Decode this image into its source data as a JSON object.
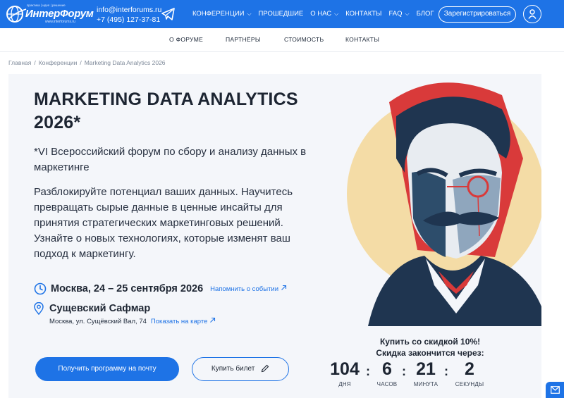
{
  "header": {
    "logo": {
      "tagline": "практика | идея | решение",
      "brand": "ИнтерФорум",
      "site": "www.interforums.ru"
    },
    "email": "info@interforums.ru",
    "phone": "+7 (495) 127-37-81",
    "nav": [
      {
        "label": "КОНФЕРЕНЦИИ",
        "dropdown": true
      },
      {
        "label": "ПРОШЕДШИЕ",
        "dropdown": false
      },
      {
        "label": "О НАС",
        "dropdown": true
      },
      {
        "label": "КОНТАКТЫ",
        "dropdown": false
      },
      {
        "label": "FAQ",
        "dropdown": true
      },
      {
        "label": "БЛОГ",
        "dropdown": false
      }
    ],
    "register_label": "Зарегистрироваться"
  },
  "subnav": [
    "О ФОРУМЕ",
    "ПАРТНЁРЫ",
    "СТОИМОСТЬ",
    "КОНТАКТЫ"
  ],
  "breadcrumb": [
    "Главная",
    "Конференции",
    "Marketing Data Analytics 2026"
  ],
  "hero": {
    "title_line1": "MARKETING DATA ANALYTICS",
    "title_line2": "2026*",
    "subtitle": "*VI Всероссийский форум по сбору и анализу данных в маркетинге",
    "lead": "Разблокируйте потенциал ваших данных. Научитесь превращать сырые данные в ценные инсайты для принятия стратегических маркетинговых решений. Узнайте о новых технологиях, которые изменят ваш подход к маркетингу.",
    "date": "Москва, 24 – 25 сентября 2026",
    "remind_link": "Напомнить о событии",
    "venue": "Сущевский Сафмар",
    "address": "Москва, ул. Сущёвский Вал, 74",
    "map_link": "Показать на карте",
    "cta_primary": "Получить программу на почту",
    "cta_secondary": "Купить билет"
  },
  "promo": {
    "line1": "Купить со скидкой 10%!",
    "line2": "Скидка закончится через:",
    "countdown": [
      {
        "value": "104",
        "label": "ДНЯ"
      },
      {
        "value": "6",
        "label": "ЧАСОВ"
      },
      {
        "value": "21",
        "label": "МИНУТА"
      },
      {
        "value": "2",
        "label": "СЕКУНДЫ"
      }
    ]
  },
  "colors": {
    "primary": "#1e73e6",
    "hero_bg": "#f4f6fa",
    "art_red": "#d93a3a",
    "art_navy": "#1f3550",
    "art_cream": "#f4dca6"
  }
}
